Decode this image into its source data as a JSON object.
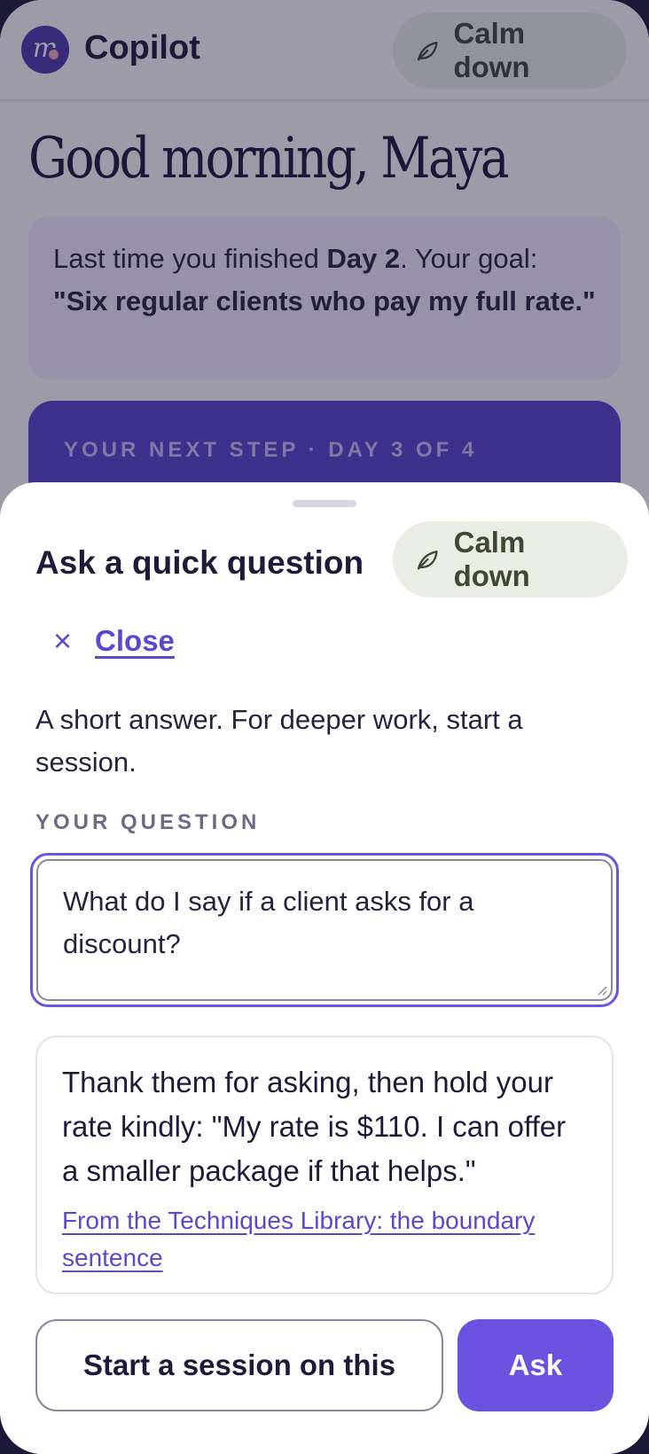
{
  "app": {
    "name": "Copilot",
    "logo_letter": "m"
  },
  "calm_button": {
    "label": "Calm down",
    "icon": "leaf-icon"
  },
  "greeting": "Good morning, Maya",
  "recap": {
    "prefix": "Last time you finished ",
    "day": "Day 2",
    "middle": ". Your goal: ",
    "goal": "\"Six regular clients who pay my full rate.\""
  },
  "next_step": {
    "label": "YOUR NEXT STEP · DAY 3 OF 4"
  },
  "sheet": {
    "title": "Ask a quick question",
    "close_label": "Close",
    "description": "A short answer. For deeper work, start a session.",
    "question_label": "YOUR QUESTION",
    "question_value": "What do I say if a client asks for a discount?",
    "answer": "Thank them for asking, then hold your rate kindly: \"My rate is $110. I can offer a smaller package if that helps.\"",
    "source_link": "From the Techniques Library: the boundary sentence",
    "start_session_label": "Start a session on this",
    "ask_label": "Ask"
  },
  "colors": {
    "accent": "#6b52df",
    "calm_bg": "#e9ede3",
    "calm_text": "#3d4a33"
  }
}
